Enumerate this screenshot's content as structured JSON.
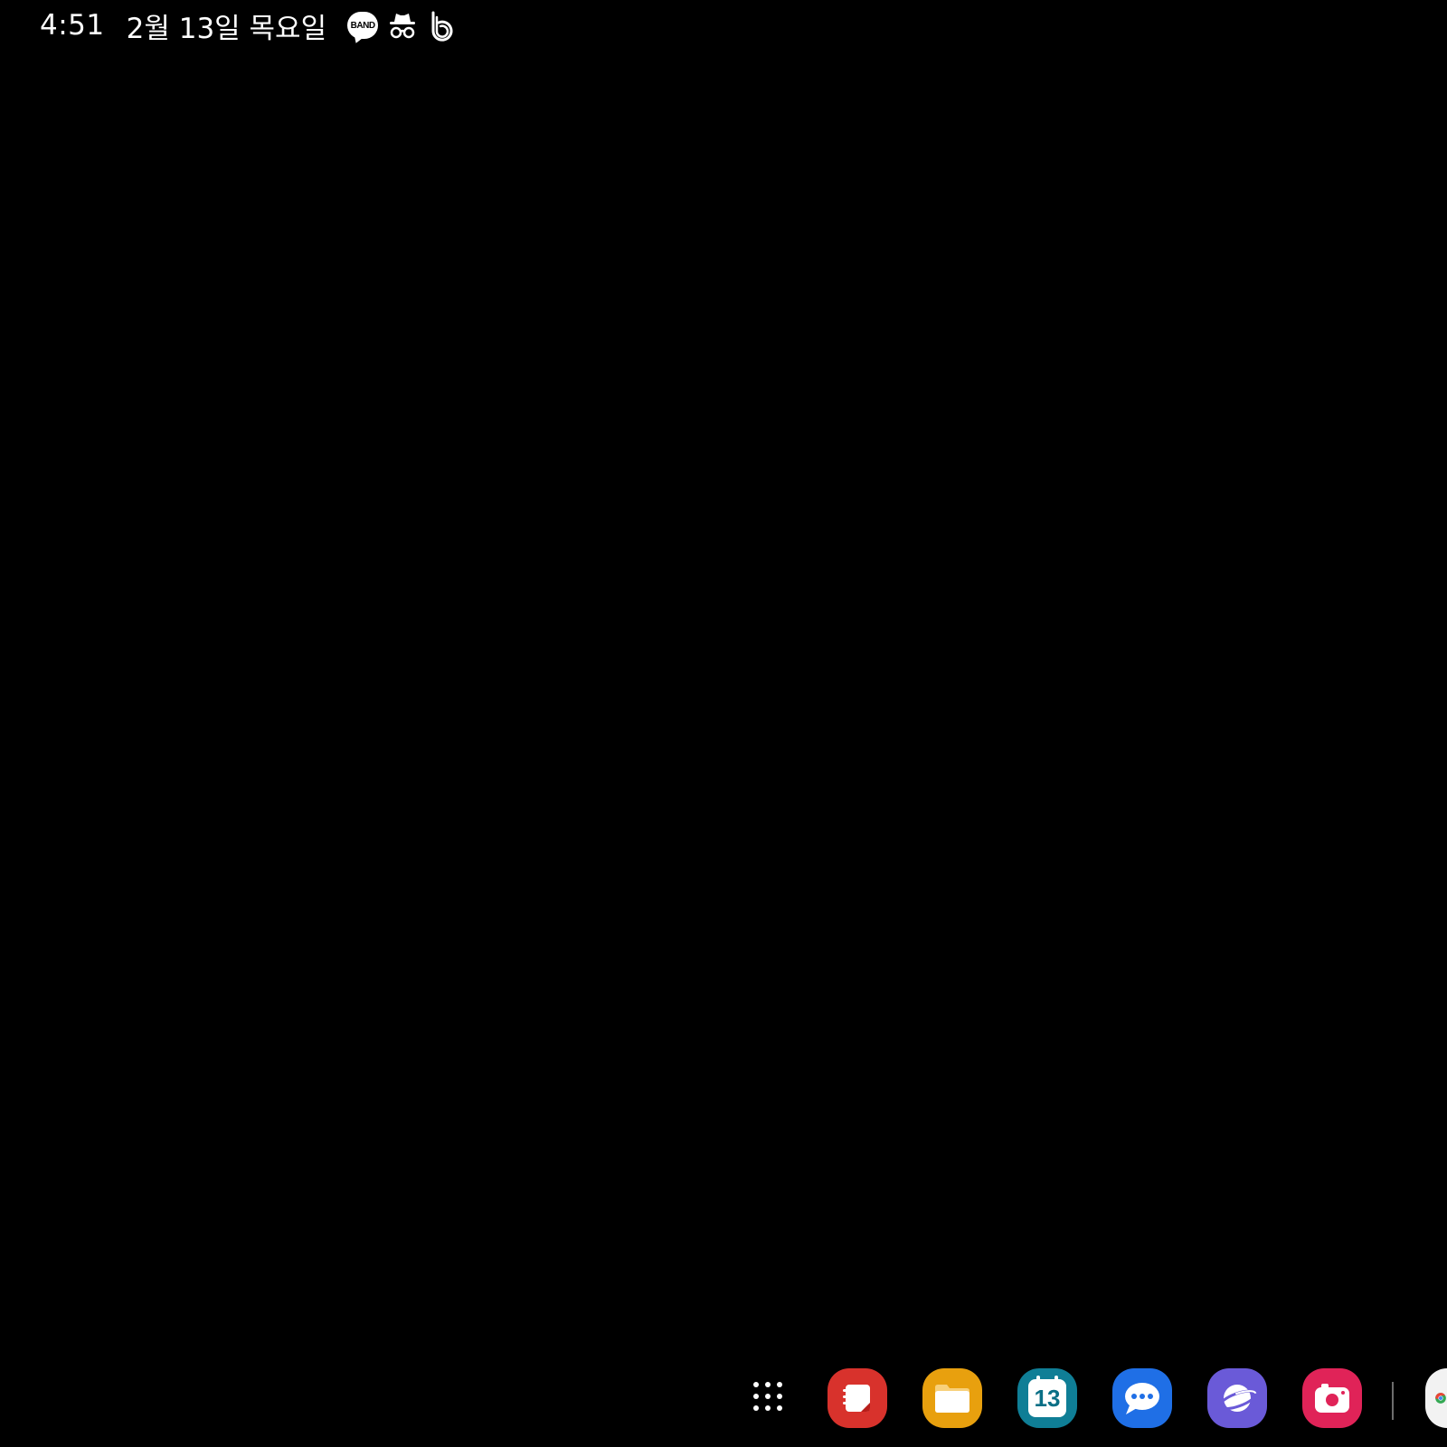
{
  "status_bar": {
    "time": "4:51",
    "date": "2월 13일 목요일",
    "notification_icons": [
      "band-icon",
      "incognito-icon",
      "bixby-icon"
    ],
    "band_label": "BAND"
  },
  "dock": {
    "apps_button": "apps-grid-icon",
    "items": [
      {
        "name": "samsung-notes",
        "icon": "notes-icon",
        "color": "#d8322c"
      },
      {
        "name": "my-files",
        "icon": "folder-icon",
        "color": "#e8a00e"
      },
      {
        "name": "calendar",
        "icon": "calendar-icon",
        "color": "#0f7e96",
        "label": "13"
      },
      {
        "name": "messages",
        "icon": "chat-bubble-icon",
        "color": "#1f6fe6"
      },
      {
        "name": "samsung-internet",
        "icon": "planet-icon",
        "color": "#6a5ad8"
      },
      {
        "name": "screen-recorder",
        "icon": "camera-icon",
        "color": "#e02358"
      },
      {
        "name": "chrome",
        "icon": "chrome-icon",
        "color": "#f2f2f2"
      }
    ]
  },
  "colors": {
    "background": "#000000",
    "text": "#ffffff"
  }
}
